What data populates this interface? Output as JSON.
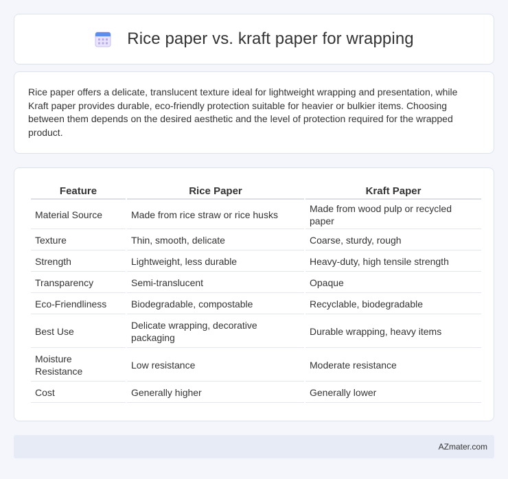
{
  "header": {
    "title": "Rice paper vs. kraft paper for wrapping",
    "icon": "calendar-icon"
  },
  "description": "Rice paper offers a delicate, translucent texture ideal for lightweight wrapping and presentation, while Kraft paper provides durable, eco-friendly protection suitable for heavier or bulkier items. Choosing between them depends on the desired aesthetic and the level of protection required for the wrapped product.",
  "table": {
    "headers": [
      "Feature",
      "Rice Paper",
      "Kraft Paper"
    ],
    "rows": [
      [
        "Material Source",
        "Made from rice straw or rice husks",
        "Made from wood pulp or recycled paper"
      ],
      [
        "Texture",
        "Thin, smooth, delicate",
        "Coarse, sturdy, rough"
      ],
      [
        "Strength",
        "Lightweight, less durable",
        "Heavy-duty, high tensile strength"
      ],
      [
        "Transparency",
        "Semi-translucent",
        "Opaque"
      ],
      [
        "Eco-Friendliness",
        "Biodegradable, compostable",
        "Recyclable, biodegradable"
      ],
      [
        "Best Use",
        "Delicate wrapping, decorative packaging",
        "Durable wrapping, heavy items"
      ],
      [
        "Moisture Resistance",
        "Low resistance",
        "Moderate resistance"
      ],
      [
        "Cost",
        "Generally higher",
        "Generally lower"
      ]
    ]
  },
  "footer": {
    "brand": "AZmater.com"
  },
  "colors": {
    "background": "#f4f6fb",
    "card": "#ffffff",
    "footer": "#e6ebf5",
    "icon_accent": "#5b8def"
  }
}
